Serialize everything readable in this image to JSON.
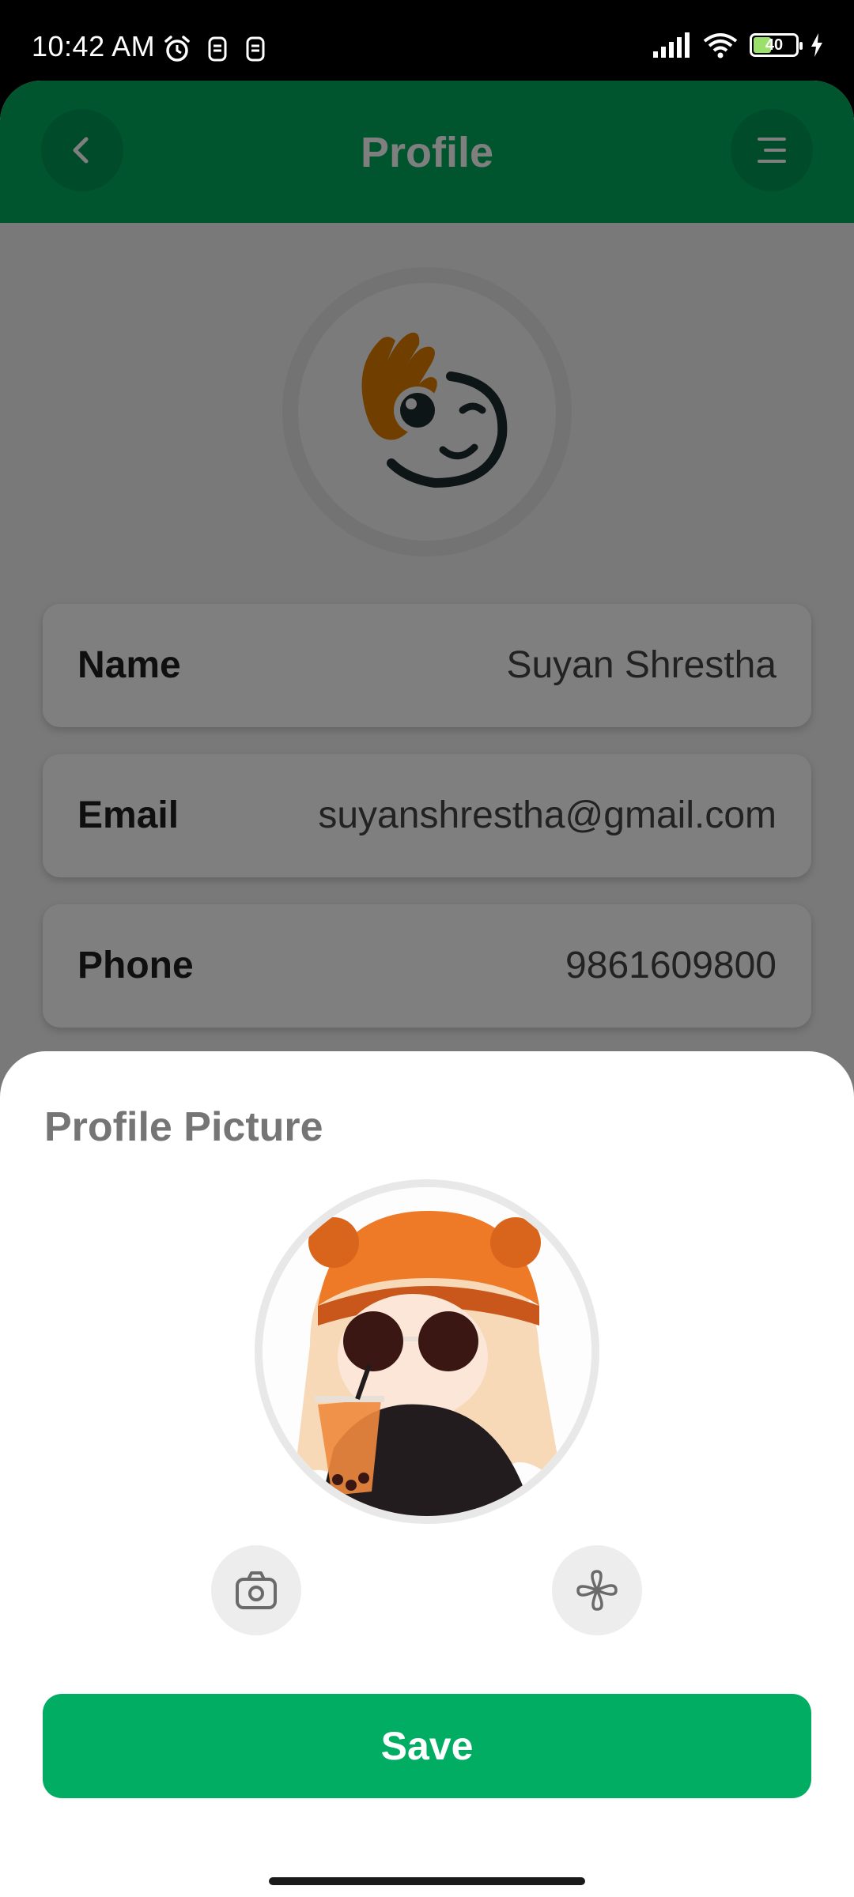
{
  "status_bar": {
    "time": "10:42 AM",
    "battery_level": "40",
    "battery_fraction": 0.4,
    "icons_left": [
      "alarm-icon",
      "notification-icon",
      "notification-icon"
    ],
    "icons_right": [
      "signal-icon",
      "wifi-icon",
      "battery-icon",
      "charging-icon"
    ]
  },
  "header": {
    "title": "Profile",
    "back_icon": "chevron-left-icon",
    "menu_icon": "menu-icon",
    "color": "#00a85c"
  },
  "profile": {
    "fields": [
      {
        "label": "Name",
        "value": "Suyan Shrestha"
      },
      {
        "label": "Email",
        "value": "suyanshrestha@gmail.com"
      },
      {
        "label": "Phone",
        "value": "9861609800"
      }
    ]
  },
  "sheet": {
    "title": "Profile Picture",
    "camera_icon": "camera-icon",
    "pinwheel_icon": "pinwheel-icon",
    "save_label": "Save",
    "save_color": "#00ad63"
  }
}
